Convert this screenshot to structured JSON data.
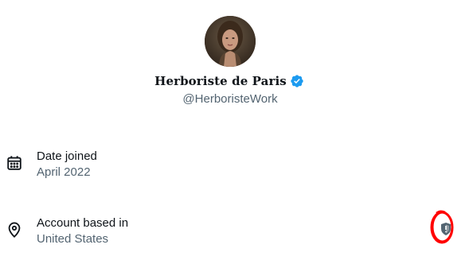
{
  "profile": {
    "display_name": "Herboriste de Paris",
    "handle": "@HerboristeWork",
    "verified": true,
    "accent_color": "#1d9bf0"
  },
  "details": [
    {
      "icon": "calendar-icon",
      "title": "Date joined",
      "value": "April 2022"
    },
    {
      "icon": "location-pin-icon",
      "title": "Account based in",
      "value": "United States"
    }
  ],
  "indicators": {
    "shield_icon": "shield-icon",
    "annotation_color": "#ff0000"
  }
}
